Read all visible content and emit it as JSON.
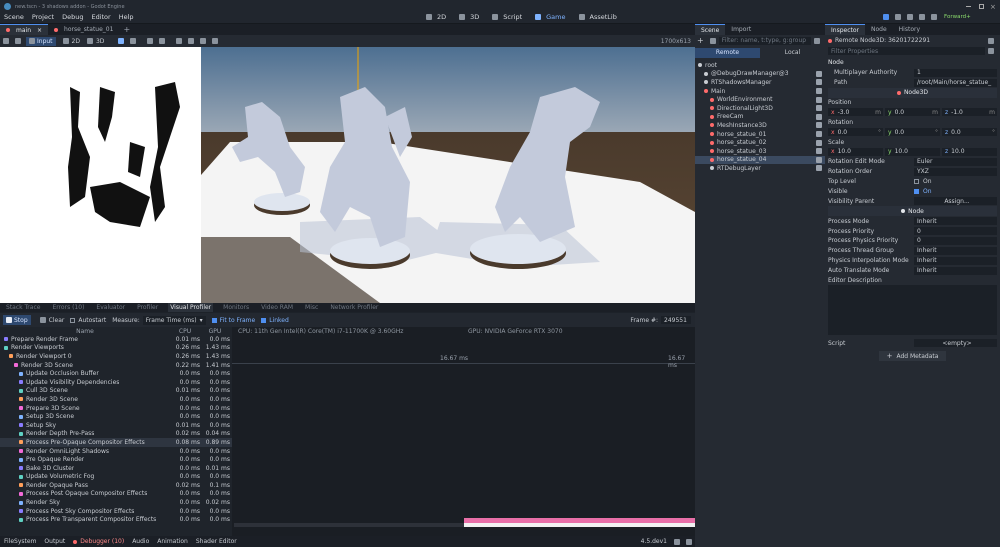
{
  "window": {
    "title": "new.tscn - 3 shadows addon - Godot Engine"
  },
  "menu": [
    "Scene",
    "Project",
    "Debug",
    "Editor",
    "Help"
  ],
  "workspaces": [
    {
      "label": "2D",
      "icon": "2d-icon"
    },
    {
      "label": "3D",
      "icon": "3d-icon"
    },
    {
      "label": "Script",
      "icon": "script-icon"
    },
    {
      "label": "Game",
      "icon": "game-icon"
    },
    {
      "label": "AssetLib",
      "icon": "assetlib-icon"
    }
  ],
  "renderer": "Forward+",
  "scene_tabs": [
    "main",
    "horse_statue_01"
  ],
  "game_toolbar": {
    "input": "Input",
    "two_d": "2D",
    "three_d": "3D",
    "fps": "1700x613"
  },
  "debugger_tabs": [
    "Stack Trace",
    "Errors (10)",
    "Evaluator",
    "Profiler",
    "Visual Profiler",
    "Monitors",
    "Video RAM",
    "Misc",
    "Network Profiler"
  ],
  "profiler": {
    "stop": "Stop",
    "clear": "Clear",
    "autostart": "Autostart",
    "measure_label": "Measure:",
    "measure_value": "Frame Time (ms)",
    "fit_to_frame": "Fit to Frame",
    "linked": "Linked",
    "frame_label": "Frame #:",
    "frame_value": "249551",
    "col_name": "Name",
    "col_cpu": "CPU",
    "col_gpu": "GPU",
    "cpu_info": "CPU: 11th Gen Intel(R) Core(TM) i7-11700K @ 3.60GHz",
    "gpu_info": "GPU: NVIDIA GeForce RTX 3070",
    "frame_ms_left": "16.67 ms",
    "frame_ms_right": "16.67 ms",
    "rows": [
      {
        "name": "Prepare Render Frame",
        "cpu": "0.01 ms",
        "gpu": "0.0 ms",
        "indent": 0
      },
      {
        "name": "Render Viewports",
        "cpu": "0.26 ms",
        "gpu": "1.43 ms",
        "indent": 0
      },
      {
        "name": "Render Viewport 0",
        "cpu": "0.26 ms",
        "gpu": "1.43 ms",
        "indent": 1
      },
      {
        "name": "Render 3D Scene",
        "cpu": "0.22 ms",
        "gpu": "1.41 ms",
        "indent": 2
      },
      {
        "name": "Update Occlusion Buffer",
        "cpu": "0.0 ms",
        "gpu": "0.0 ms",
        "indent": 3
      },
      {
        "name": "Update Visibility Dependencies",
        "cpu": "0.0 ms",
        "gpu": "0.0 ms",
        "indent": 3
      },
      {
        "name": "Cull 3D Scene",
        "cpu": "0.01 ms",
        "gpu": "0.0 ms",
        "indent": 3
      },
      {
        "name": "Render 3D Scene",
        "cpu": "0.0 ms",
        "gpu": "0.0 ms",
        "indent": 3
      },
      {
        "name": "Prepare 3D Scene",
        "cpu": "0.0 ms",
        "gpu": "0.0 ms",
        "indent": 3
      },
      {
        "name": "Setup 3D Scene",
        "cpu": "0.0 ms",
        "gpu": "0.0 ms",
        "indent": 3
      },
      {
        "name": "Setup Sky",
        "cpu": "0.01 ms",
        "gpu": "0.0 ms",
        "indent": 3
      },
      {
        "name": "Render Depth Pre-Pass",
        "cpu": "0.02 ms",
        "gpu": "0.04 ms",
        "indent": 3
      },
      {
        "name": "Process Pre-Opaque Compositor Effects",
        "cpu": "0.08 ms",
        "gpu": "0.89 ms",
        "indent": 3
      },
      {
        "name": "Render OmniLight Shadows",
        "cpu": "0.0 ms",
        "gpu": "0.0 ms",
        "indent": 3
      },
      {
        "name": "Pre Opaque Render",
        "cpu": "0.0 ms",
        "gpu": "0.0 ms",
        "indent": 3
      },
      {
        "name": "Bake 3D Cluster",
        "cpu": "0.0 ms",
        "gpu": "0.01 ms",
        "indent": 3
      },
      {
        "name": "Update Volumetric Fog",
        "cpu": "0.0 ms",
        "gpu": "0.0 ms",
        "indent": 3
      },
      {
        "name": "Render Opaque Pass",
        "cpu": "0.02 ms",
        "gpu": "0.1 ms",
        "indent": 3
      },
      {
        "name": "Process Post Opaque Compositor Effects",
        "cpu": "0.0 ms",
        "gpu": "0.0 ms",
        "indent": 3
      },
      {
        "name": "Render Sky",
        "cpu": "0.0 ms",
        "gpu": "0.02 ms",
        "indent": 3
      },
      {
        "name": "Process Post Sky Compositor Effects",
        "cpu": "0.0 ms",
        "gpu": "0.0 ms",
        "indent": 3
      },
      {
        "name": "Process Pre Transparent Compositor Effects",
        "cpu": "0.0 ms",
        "gpu": "0.0 ms",
        "indent": 3
      }
    ]
  },
  "bottom_tabs": [
    "FileSystem",
    "Output",
    "Debugger (10)",
    "Audio",
    "Animation",
    "Shader Editor"
  ],
  "version": "4.5.dev1",
  "scene_dock": {
    "tabs": [
      "Scene",
      "Import"
    ],
    "filter_placeholder": "Filter: name, t:type, g:group",
    "remote": "Remote",
    "local": "Local",
    "nodes": [
      {
        "name": "root",
        "indent": 0,
        "color": "#c8ccd2"
      },
      {
        "name": "@DebugDrawManager@3",
        "indent": 1,
        "color": "#c8ccd2"
      },
      {
        "name": "RTShadowsManager",
        "indent": 1,
        "color": "#c8ccd2"
      },
      {
        "name": "Main",
        "indent": 1,
        "color": "#ff6b6b"
      },
      {
        "name": "WorldEnvironment",
        "indent": 2,
        "color": "#ff6b6b"
      },
      {
        "name": "DirectionalLight3D",
        "indent": 2,
        "color": "#ff6b6b"
      },
      {
        "name": "FreeCam",
        "indent": 2,
        "color": "#ff6b6b"
      },
      {
        "name": "MeshInstance3D",
        "indent": 2,
        "color": "#ff6b6b"
      },
      {
        "name": "horse_statue_01",
        "indent": 2,
        "color": "#ff6b6b"
      },
      {
        "name": "horse_statue_02",
        "indent": 2,
        "color": "#ff6b6b"
      },
      {
        "name": "horse_statue_03",
        "indent": 2,
        "color": "#ff6b6b"
      },
      {
        "name": "horse_statue_04",
        "indent": 2,
        "color": "#ff6b6b"
      },
      {
        "name": "RTDebugLayer",
        "indent": 2,
        "color": "#c8ccd2"
      }
    ]
  },
  "inspector": {
    "tabs": [
      "Inspector",
      "Node",
      "History"
    ],
    "remote_node": "Remote Node3D: 36201722291",
    "filter_placeholder": "Filter Properties",
    "section_node": "Node",
    "multiplayer_label": "Multiplayer Authority",
    "multiplayer_value": "1",
    "path_label": "Path",
    "path_value": "/root/Main/horse_statue_",
    "section_node3d": "Node3D",
    "position_label": "Position",
    "position": {
      "x": "-3.0",
      "y": "0.0",
      "z": "-1.0"
    },
    "position_units": {
      "x": "m",
      "y": "m",
      "z": "m"
    },
    "rotation_label": "Rotation",
    "rotation": {
      "x": "0.0",
      "y": "0.0",
      "z": "0.0"
    },
    "rotation_units": {
      "x": "°",
      "y": "°",
      "z": "°"
    },
    "scale_label": "Scale",
    "scale": {
      "x": "10.0",
      "y": "10.0",
      "z": "10.0"
    },
    "rotation_edit_mode_label": "Rotation Edit Mode",
    "rotation_edit_mode_value": "Euler",
    "rotation_order_label": "Rotation Order",
    "rotation_order_value": "YXZ",
    "top_level_label": "Top Level",
    "top_level_value": "On",
    "visible_label": "Visible",
    "visible_value": "On",
    "visibility_parent_label": "Visibility Parent",
    "visibility_parent_value": "Assign...",
    "section_node2": "Node",
    "process_mode_label": "Process Mode",
    "process_mode_value": "Inherit",
    "process_priority_label": "Process Priority",
    "process_priority_value": "0",
    "physics_priority_label": "Process Physics Priority",
    "physics_priority_value": "0",
    "thread_group_label": "Process Thread Group",
    "thread_group_value": "Inherit",
    "physics_interp_label": "Physics Interpolation Mode",
    "physics_interp_value": "Inherit",
    "auto_translate_label": "Auto Translate Mode",
    "auto_translate_value": "Inherit",
    "editor_desc_label": "Editor Description",
    "script_label": "Script",
    "script_value": "<empty>",
    "add_metadata": "Add Metadata"
  },
  "colors": {
    "accent": "#4f8ff0",
    "pink_bar": "#e86fa8",
    "node_red": "#ff6b6b"
  }
}
